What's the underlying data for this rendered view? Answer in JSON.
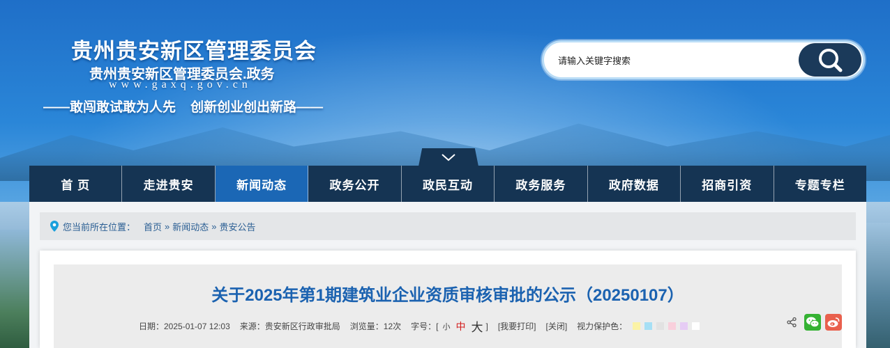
{
  "header": {
    "title": "贵州贵安新区管理委员会",
    "subtitle": "贵州贵安新区管理委员会.政务",
    "url": "www.gaxq.gov.cn",
    "slogan": "——敢闯敢试敢为人先    创新创业创出新路——"
  },
  "search": {
    "placeholder": "请输入关键字搜索",
    "button_icon": "search-icon"
  },
  "nav": {
    "toggle_icon": "chevron-down-icon",
    "items": [
      {
        "label": "首 页"
      },
      {
        "label": "走进贵安"
      },
      {
        "label": "新闻动态",
        "active": true
      },
      {
        "label": "政务公开"
      },
      {
        "label": "政民互动"
      },
      {
        "label": "政务服务"
      },
      {
        "label": "政府数据"
      },
      {
        "label": "招商引资"
      },
      {
        "label": "专题专栏"
      }
    ]
  },
  "breadcrumb": {
    "icon": "location-pin-icon",
    "label": "您当前所在位置：",
    "items": [
      "首页",
      "新闻动态",
      "贵安公告"
    ],
    "separator": "»"
  },
  "article": {
    "title": "关于2025年第1期建筑业企业资质审核审批的公示（20250107）",
    "date": "日期：2025-01-07 12:03",
    "source": "来源：贵安新区行政审批局",
    "views": "浏览量：12次",
    "font_label": "字号：[",
    "font_small": "小",
    "font_medium": "中",
    "font_large": "大",
    "font_end": "]",
    "print": "[我要打印]",
    "close": "[关闭]",
    "protect_label": "视力保护色：",
    "protect_colors": [
      "#fbf3a6",
      "#a6dff5",
      "#e2e2e2",
      "#f9d0dc",
      "#e6ccf5",
      "#ffffff"
    ]
  },
  "share": {
    "icons": [
      "share-icon",
      "wechat-icon",
      "weibo-icon"
    ],
    "wechat_color": "#35b233",
    "weibo_color": "#e9604d"
  },
  "colors": {
    "nav_bg": "#153453",
    "nav_active": "#1b67b5",
    "title_blue": "#1b62b0",
    "font_medium_red": "#d21b1b"
  }
}
